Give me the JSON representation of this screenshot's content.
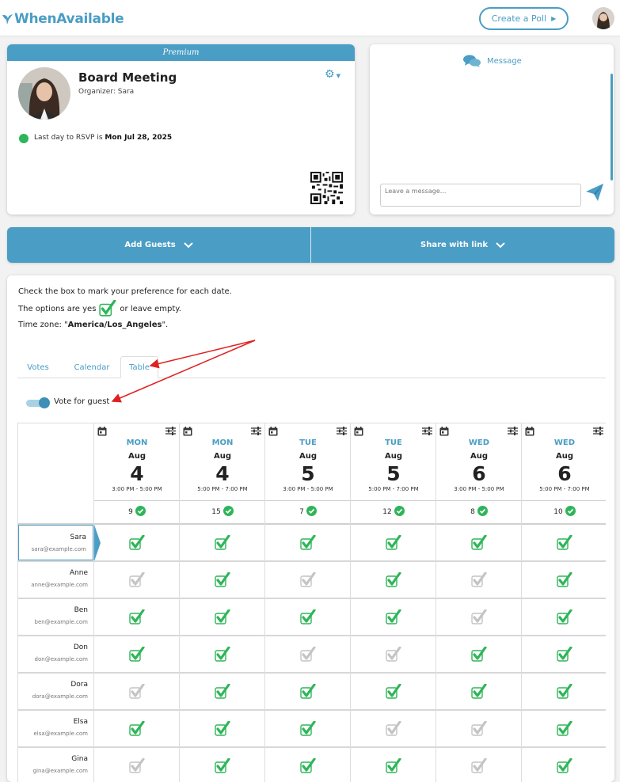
{
  "app": {
    "brand": "WhenAvailable",
    "create_poll": "Create a Poll"
  },
  "event": {
    "badge": "Premium",
    "title": "Board Meeting",
    "organizer": "Organizer: Sara",
    "rsvp_prefix": "Last day to RSVP is ",
    "rsvp_date": "Mon Jul 28, 2025"
  },
  "message": {
    "label": "Message",
    "placeholder": "Leave a message..."
  },
  "actions": {
    "add_guests": "Add Guests",
    "share": "Share with link"
  },
  "instructions": {
    "line1": "Check the box to mark your preference for each date.",
    "line2_a": "The options are  yes",
    "line2_b": "or leave empty.",
    "line3_a": "Time zone: \"",
    "tz": "America/Los_Angeles",
    "line3_b": "\"."
  },
  "tabs": [
    "Votes",
    "Calendar",
    "Table"
  ],
  "active_tab": "Table",
  "toggle": {
    "label": "Vote for guest",
    "on": true
  },
  "colors": {
    "accent": "#4a9dc4",
    "yes": "#2fb559",
    "no": "#c4c4c4"
  },
  "columns": [
    {
      "dow": "MON",
      "month": "Aug",
      "day": "4",
      "time": "3:00 PM - 5:00 PM",
      "count": "9"
    },
    {
      "dow": "MON",
      "month": "Aug",
      "day": "4",
      "time": "5:00 PM - 7:00 PM",
      "count": "15"
    },
    {
      "dow": "TUE",
      "month": "Aug",
      "day": "5",
      "time": "3:00 PM - 5:00 PM",
      "count": "7"
    },
    {
      "dow": "TUE",
      "month": "Aug",
      "day": "5",
      "time": "5:00 PM - 7:00 PM",
      "count": "12"
    },
    {
      "dow": "WED",
      "month": "Aug",
      "day": "6",
      "time": "3:00 PM - 5:00 PM",
      "count": "8"
    },
    {
      "dow": "WED",
      "month": "Aug",
      "day": "6",
      "time": "5:00 PM - 7:00 PM",
      "count": "10"
    }
  ],
  "rows": [
    {
      "name": "Sara",
      "email": "sara@example.com",
      "votes": [
        1,
        1,
        1,
        1,
        1,
        1
      ]
    },
    {
      "name": "Anne",
      "email": "anne@example.com",
      "votes": [
        0,
        1,
        0,
        1,
        0,
        1
      ]
    },
    {
      "name": "Ben",
      "email": "ben@example.com",
      "votes": [
        1,
        1,
        1,
        1,
        0,
        1
      ]
    },
    {
      "name": "Don",
      "email": "don@example.com",
      "votes": [
        1,
        1,
        0,
        0,
        1,
        1
      ]
    },
    {
      "name": "Dora",
      "email": "dora@example.com",
      "votes": [
        0,
        1,
        1,
        1,
        1,
        1
      ]
    },
    {
      "name": "Elsa",
      "email": "elsa@example.com",
      "votes": [
        1,
        1,
        1,
        0,
        0,
        1
      ]
    },
    {
      "name": "Gina",
      "email": "gina@example.com",
      "votes": [
        0,
        1,
        1,
        1,
        0,
        1
      ]
    }
  ],
  "selected_row": 0
}
